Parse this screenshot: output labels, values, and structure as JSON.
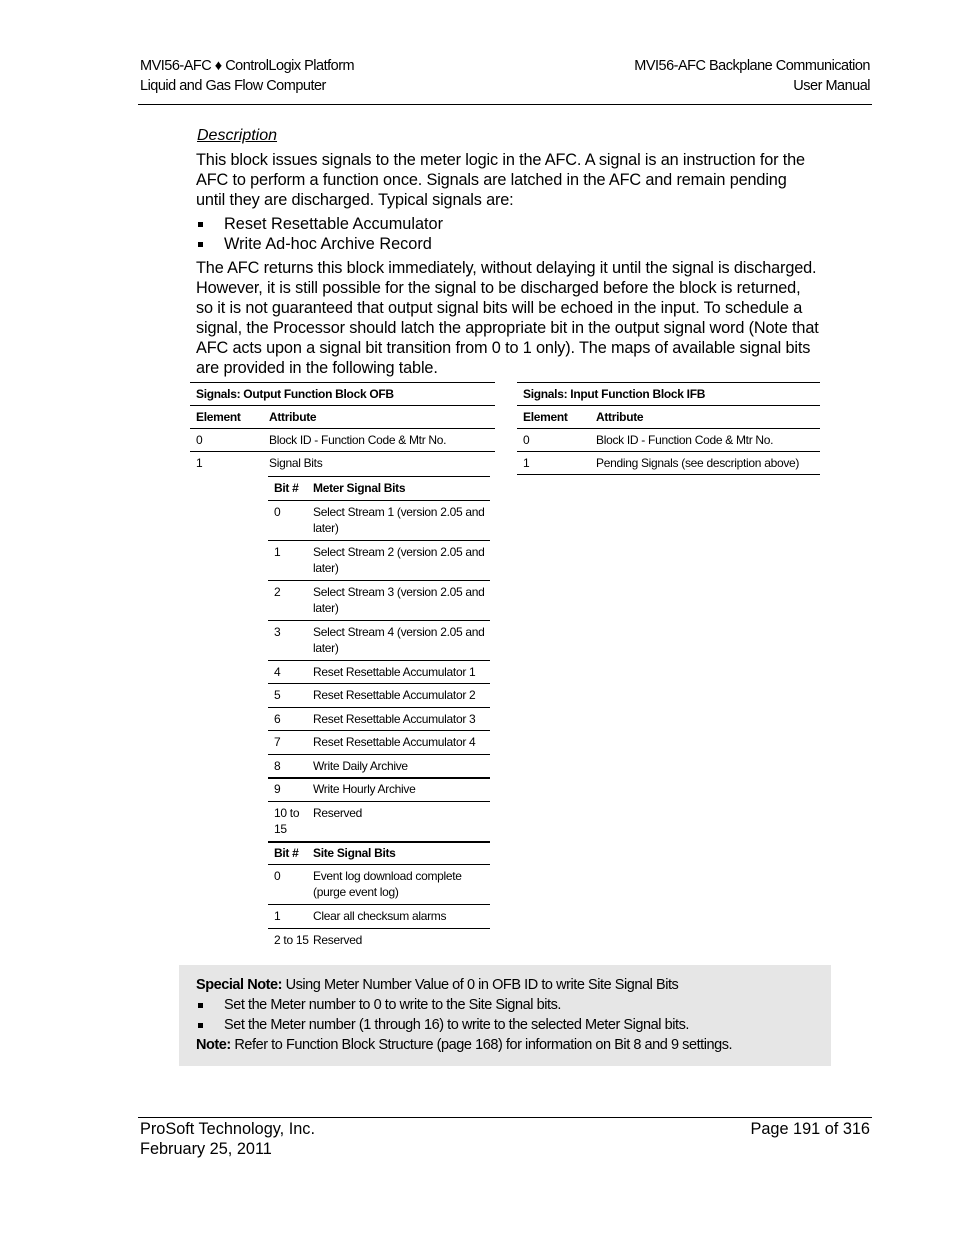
{
  "header": {
    "left_line1": "MVI56-AFC ♦ ControlLogix Platform",
    "left_line2": "Liquid and Gas Flow Computer",
    "right_line1": "MVI56-AFC Backplane Communication",
    "right_line2": "User Manual"
  },
  "description": {
    "title": "Description",
    "paragraph1": "This block issues signals to the meter logic in the AFC. A signal is an instruction for the AFC to perform a function once. Signals are latched in the AFC and remain pending until they are discharged. Typical signals are:",
    "bullets": [
      "Reset Resettable Accumulator",
      "Write Ad-hoc Archive Record"
    ],
    "paragraph2": "The AFC returns this block immediately, without delaying it until the signal is discharged. However, it is still possible for the signal to be discharged before the block is returned, so it is not guaranteed that output signal bits will be echoed in the input. To schedule a signal, the Processor should latch the appropriate bit in the output signal word (Note that AFC acts upon a signal bit transition from 0 to 1 only). The maps of available signal bits are provided in the following table."
  },
  "ofb_table": {
    "title": "Signals: Output Function Block OFB",
    "headers": [
      "Element",
      "Attribute"
    ],
    "rows": [
      {
        "element": "0",
        "attribute": "Block ID - Function Code & Mtr No."
      },
      {
        "element": "1",
        "attribute": "Signal Bits"
      }
    ],
    "meter_bits": {
      "headers": [
        "Bit #",
        "Meter Signal Bits"
      ],
      "rows": [
        {
          "bit": "0",
          "desc": "Select Stream 1 (version 2.05 and later)"
        },
        {
          "bit": "1",
          "desc": "Select Stream 2 (version 2.05 and later)"
        },
        {
          "bit": "2",
          "desc": "Select Stream 3 (version 2.05 and later)"
        },
        {
          "bit": "3",
          "desc": "Select Stream 4 (version 2.05 and later)"
        },
        {
          "bit": "4",
          "desc": "Reset Resettable Accumulator 1"
        },
        {
          "bit": "5",
          "desc": "Reset Resettable Accumulator 2"
        },
        {
          "bit": "6",
          "desc": "Reset Resettable Accumulator 3"
        },
        {
          "bit": "7",
          "desc": "Reset Resettable Accumulator 4"
        },
        {
          "bit": "8",
          "desc": "Write Daily Archive"
        },
        {
          "bit": "9",
          "desc": "Write Hourly Archive"
        },
        {
          "bit": "10 to 15",
          "desc": "Reserved"
        }
      ]
    },
    "site_bits": {
      "headers": [
        "Bit #",
        "Site Signal Bits"
      ],
      "rows": [
        {
          "bit": "0",
          "desc": "Event log download complete (purge event log)"
        },
        {
          "bit": "1",
          "desc": "Clear all checksum alarms"
        },
        {
          "bit": "2 to 15",
          "desc": "Reserved"
        }
      ]
    }
  },
  "ifb_table": {
    "title": "Signals: Input Function Block IFB",
    "headers": [
      "Element",
      "Attribute"
    ],
    "rows": [
      {
        "element": "0",
        "attribute": "Block ID - Function Code & Mtr No."
      },
      {
        "element": "1",
        "attribute": "Pending Signals (see description above)"
      }
    ]
  },
  "note_box": {
    "special_label": "Special Note:",
    "special_text": " Using Meter Number Value of 0 in OFB ID to write Site Signal Bits",
    "bullets": [
      "Set the Meter number to 0 to write to the Site Signal bits.",
      "Set the Meter number (1 through 16) to write to the selected Meter Signal bits."
    ],
    "note_label": "Note:",
    "note_text": " Refer to Function Block Structure (page 168) for information on Bit 8 and 9 settings."
  },
  "footer": {
    "company": "ProSoft Technology, Inc.",
    "date": "February 25, 2011",
    "page": "Page 191 of 316"
  }
}
